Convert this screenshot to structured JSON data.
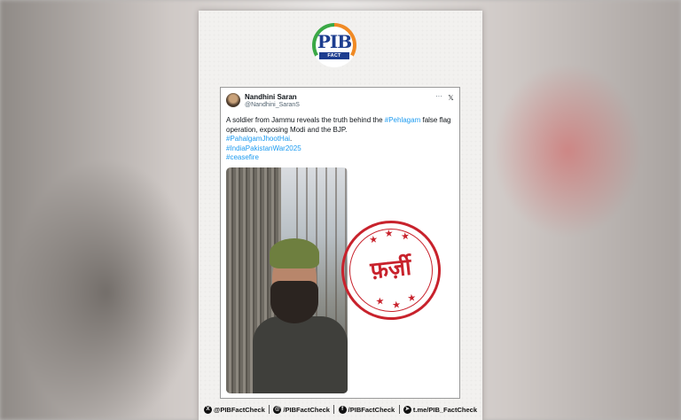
{
  "logo": {
    "text": "PIB",
    "subtitle": "FACT CHECK"
  },
  "tweet": {
    "author_name": "Nandhini Saran",
    "author_handle": "@Nandhini_SaranS",
    "more_glyph": "···",
    "x_glyph": "𝕏",
    "text_line1_pre": "A soldier from Jammu reveals the truth behind the ",
    "hashtag1": "#Pehlagam",
    "text_line1_post": " false flag operation, exposing Modi and the BJP.",
    "hashtag2": "#PahalgamJhootHai",
    "hashtag2_suffix": ".",
    "hashtag3": "#IndiaPakistanWar2025",
    "hashtag4": "#ceasefire"
  },
  "stamp": {
    "text": "फ़र्ज़ी",
    "color": "#c8222c"
  },
  "footer": {
    "items": [
      {
        "icon": "x-icon",
        "glyph": "X",
        "label": "@PIBFactCheck"
      },
      {
        "icon": "threads-icon",
        "glyph": "@",
        "label": "/PIBFactCheck"
      },
      {
        "icon": "facebook-icon",
        "glyph": "f",
        "label": "/PIBFactCheck"
      },
      {
        "icon": "telegram-icon",
        "glyph": "➤",
        "label": "t.me/PIB_FactCheck"
      }
    ]
  },
  "colors": {
    "hashtag": "#1d9bf0",
    "brand_blue": "#1d3d8f",
    "saffron": "#f08a24",
    "green": "#3aa845"
  }
}
